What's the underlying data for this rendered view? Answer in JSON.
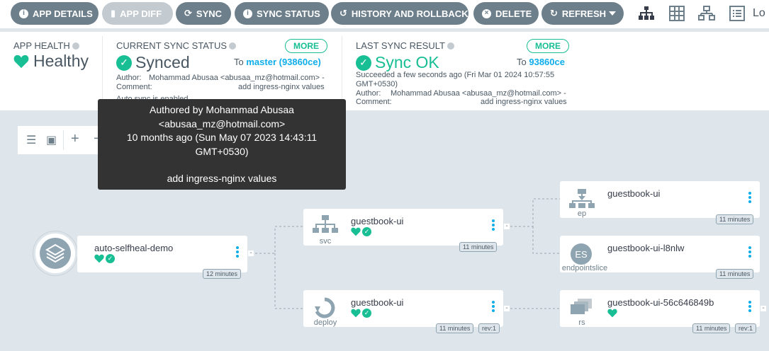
{
  "toolbar": {
    "app_details": "APP DETAILS",
    "app_diff": "APP DIFF",
    "sync": "SYNC",
    "sync_status": "SYNC STATUS",
    "history": "HISTORY AND ROLLBACK",
    "delete": "DELETE",
    "refresh": "REFRESH",
    "logout": "Lo"
  },
  "app_health": {
    "header": "APP HEALTH",
    "value": "Healthy"
  },
  "current_sync": {
    "header": "CURRENT SYNC STATUS",
    "value": "Synced",
    "more": "MORE",
    "to_prefix": "To",
    "to_target": "master (93860ce)",
    "author_label": "Author:",
    "author_value": "Mohammad Abusaa <abusaa_mz@hotmail.com> -",
    "comment_label": "Comment:",
    "comment_value": "add ingress-nginx values",
    "auto_sync": "Auto sync is enabled."
  },
  "last_sync": {
    "header": "LAST SYNC RESULT",
    "value": "Sync OK",
    "more": "MORE",
    "to_prefix": "To",
    "to_target": "93860ce",
    "succeeded_line1": "Succeeded a few seconds ago (Fri Mar 01 2024 10:57:55",
    "succeeded_line2": "GMT+0530)",
    "author_label": "Author:",
    "author_value": "Mohammad Abusaa <abusaa_mz@hotmail.com> -",
    "comment_label": "Comment:",
    "comment_value": "add ingress-nginx values"
  },
  "tooltip": {
    "line1": "Authored by Mohammad Abusaa",
    "line2": "<abusaa_mz@hotmail.com>",
    "line3": "10 months ago (Sun May 07 2023 14:43:11",
    "line4": "GMT+0530)",
    "line5": "add ingress-nginx values"
  },
  "nodes": {
    "app": {
      "name": "auto-selfheal-demo",
      "age": "12 minutes"
    },
    "svc": {
      "name": "guestbook-ui",
      "kind": "svc",
      "age": "11 minutes"
    },
    "deploy": {
      "name": "guestbook-ui",
      "kind": "deploy",
      "age": "11 minutes",
      "rev": "rev:1"
    },
    "ep": {
      "name": "guestbook-ui",
      "kind": "ep",
      "age": "11 minutes"
    },
    "eps": {
      "name": "guestbook-ui-l8nlw",
      "kind": "endpointslice",
      "badge": "ES",
      "age": "11 minutes"
    },
    "rs": {
      "name": "guestbook-ui-56c646849b",
      "kind": "rs",
      "age": "11 minutes",
      "rev": "rev:1"
    }
  },
  "colors": {
    "accent": "#18be94",
    "link": "#0dadea",
    "button": "#6d7f8b"
  }
}
